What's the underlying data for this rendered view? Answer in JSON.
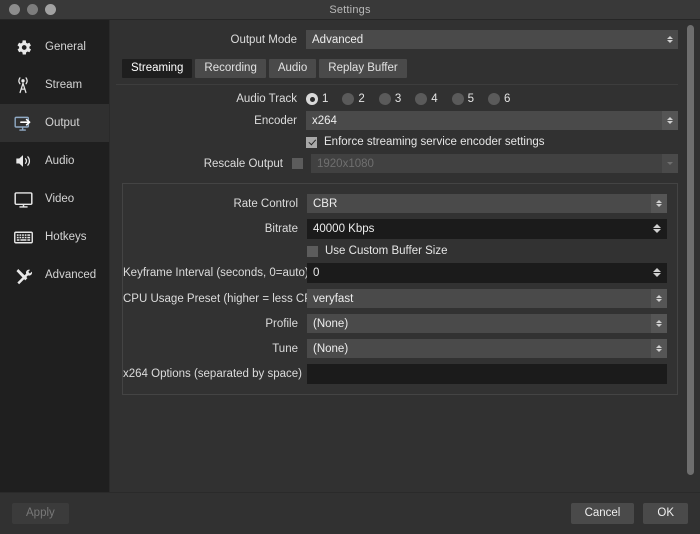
{
  "window": {
    "title": "Settings",
    "traffic_lights": [
      "close-button",
      "minimize-button",
      "zoom-button"
    ]
  },
  "sidebar": {
    "items": [
      {
        "label": "General",
        "icon": "gear-icon",
        "active": false
      },
      {
        "label": "Stream",
        "icon": "broadcast-icon",
        "active": false
      },
      {
        "label": "Output",
        "icon": "output-icon",
        "active": true
      },
      {
        "label": "Audio",
        "icon": "speaker-icon",
        "active": false
      },
      {
        "label": "Video",
        "icon": "monitor-icon",
        "active": false
      },
      {
        "label": "Hotkeys",
        "icon": "keyboard-icon",
        "active": false
      },
      {
        "label": "Advanced",
        "icon": "tools-icon",
        "active": false
      }
    ]
  },
  "output_mode": {
    "label": "Output Mode",
    "value": "Advanced"
  },
  "tabs": [
    {
      "label": "Streaming",
      "active": true
    },
    {
      "label": "Recording",
      "active": false
    },
    {
      "label": "Audio",
      "active": false
    },
    {
      "label": "Replay Buffer",
      "active": false
    }
  ],
  "streaming": {
    "audio_track": {
      "label": "Audio Track",
      "options": [
        "1",
        "2",
        "3",
        "4",
        "5",
        "6"
      ],
      "selected": "1"
    },
    "encoder": {
      "label": "Encoder",
      "value": "x264"
    },
    "enforce": {
      "label": "Enforce streaming service encoder settings",
      "checked": true
    },
    "rescale_output": {
      "label": "Rescale Output",
      "checked": false,
      "value": "1920x1080",
      "enabled": false
    },
    "rate_control": {
      "label": "Rate Control",
      "value": "CBR"
    },
    "bitrate": {
      "label": "Bitrate",
      "value": "40000 Kbps"
    },
    "custom_buffer": {
      "label": "Use Custom Buffer Size",
      "checked": false
    },
    "keyframe_interval": {
      "label": "Keyframe Interval (seconds, 0=auto)",
      "value": "0"
    },
    "cpu_preset": {
      "label": "CPU Usage Preset (higher = less CPU)",
      "value": "veryfast"
    },
    "profile": {
      "label": "Profile",
      "value": "(None)"
    },
    "tune": {
      "label": "Tune",
      "value": "(None)"
    },
    "x264_options": {
      "label": "x264 Options (separated by space)",
      "value": ""
    }
  },
  "footer": {
    "apply": "Apply",
    "cancel": "Cancel",
    "ok": "OK"
  },
  "colors": {
    "window_bg": "#313131",
    "sidebar_bg": "#1f1f1f",
    "accent_field": "#4a4a4a",
    "input_bg": "#1b1b1b"
  }
}
